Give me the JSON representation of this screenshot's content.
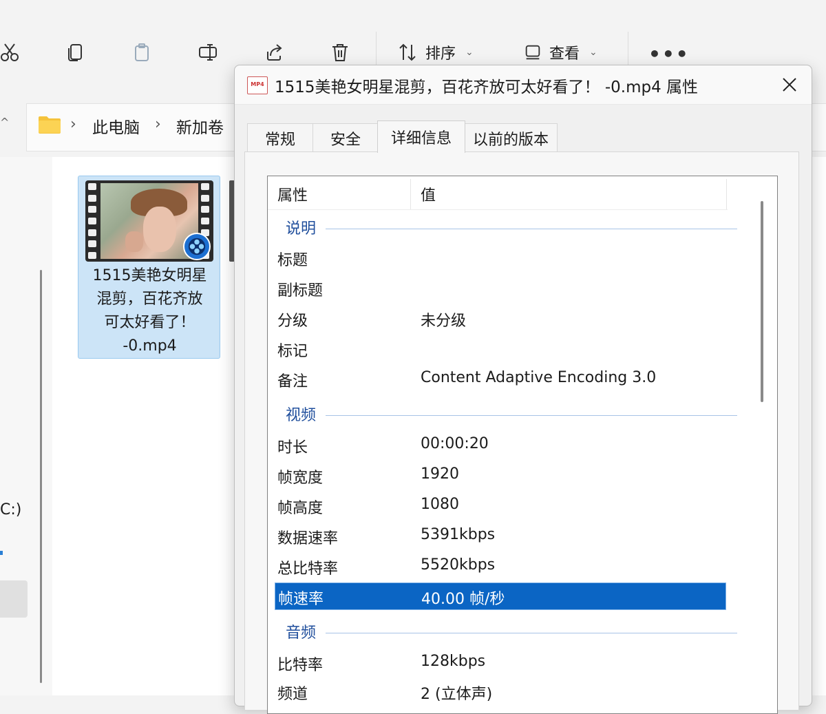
{
  "toolbar": {
    "icons": [
      "cut-icon",
      "copy-icon",
      "paste-icon",
      "rename-icon",
      "share-icon",
      "delete-icon"
    ],
    "sort_label": "排序",
    "view_label": "查看",
    "more_label": "•••"
  },
  "address": {
    "crumbs": [
      "此电脑",
      "新加卷"
    ],
    "sep": "›"
  },
  "nav": {
    "drive_label": "C:)"
  },
  "file": {
    "name_lines": [
      "1515美艳女明星",
      "混剪，百花齐放",
      "可太好看了！",
      "-0.mp4"
    ]
  },
  "dialog": {
    "title": "1515美艳女明星混剪，百花齐放可太好看了！ -0.mp4 属性",
    "file_icon_text": "MP4",
    "tabs": [
      "常规",
      "安全",
      "详细信息",
      "以前的版本"
    ],
    "active_tab": "详细信息",
    "columns": [
      "属性",
      "值"
    ],
    "groups": {
      "desc": "说明",
      "video": "视频",
      "audio": "音频"
    },
    "rows": [
      {
        "k": "标题",
        "v": ""
      },
      {
        "k": "副标题",
        "v": ""
      },
      {
        "k": "分级",
        "v": "未分级"
      },
      {
        "k": "标记",
        "v": ""
      },
      {
        "k": "备注",
        "v": "Content Adaptive Encoding 3.0"
      },
      {
        "k": "时长",
        "v": "00:00:20"
      },
      {
        "k": "帧宽度",
        "v": "1920"
      },
      {
        "k": "帧高度",
        "v": "1080"
      },
      {
        "k": "数据速率",
        "v": "5391kbps"
      },
      {
        "k": "总比特率",
        "v": "5520kbps"
      },
      {
        "k": "帧速率",
        "v": "40.00 帧/秒"
      },
      {
        "k": "比特率",
        "v": "128kbps"
      },
      {
        "k": "频道",
        "v": "2 (立体声)"
      }
    ]
  }
}
